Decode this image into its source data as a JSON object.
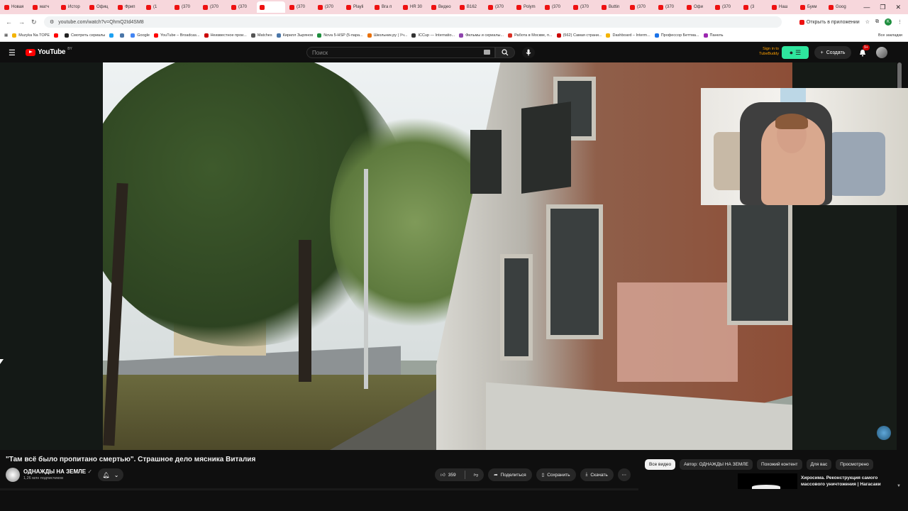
{
  "browser": {
    "tabs": [
      {
        "label": "Новая"
      },
      {
        "label": "матч"
      },
      {
        "label": "Истор"
      },
      {
        "label": "Офиц"
      },
      {
        "label": "Фрип"
      },
      {
        "label": "(1"
      },
      {
        "label": "(370"
      },
      {
        "label": "(370"
      },
      {
        "label": "(370"
      },
      {
        "label": ""
      },
      {
        "label": "(370"
      },
      {
        "label": "(370"
      },
      {
        "label": "Playli"
      },
      {
        "label": "Вга п"
      },
      {
        "label": "HR 30"
      },
      {
        "label": "Видео"
      },
      {
        "label": "В162"
      },
      {
        "label": "(370"
      },
      {
        "label": "Polym"
      },
      {
        "label": "(370"
      },
      {
        "label": "(370"
      },
      {
        "label": "Buttin"
      },
      {
        "label": "(370"
      },
      {
        "label": "(370"
      },
      {
        "label": "Офи"
      },
      {
        "label": "(370"
      },
      {
        "label": "(3"
      },
      {
        "label": "Наш"
      },
      {
        "label": "Букм"
      },
      {
        "label": "Goog"
      }
    ],
    "url": "youtube.com/watch?v=QhmQ2Id4SM8",
    "open_in_app": "Открыть в приложении",
    "profile_initial": "K",
    "bookmarks": [
      {
        "label": "Muzyka Na TOPE",
        "color": "#f4b400"
      },
      {
        "label": "",
        "color": "#ff0000"
      },
      {
        "label": "Смотреть сериалы",
        "color": "#222222"
      },
      {
        "label": "",
        "color": "#1da1f2"
      },
      {
        "label": "",
        "color": "#4a76a8"
      },
      {
        "label": "Google",
        "color": "#4285f4"
      },
      {
        "label": "YouTube – Broadcas...",
        "color": "#ff0000"
      },
      {
        "label": "Неизвестное прои...",
        "color": "#cc0000"
      },
      {
        "label": "Matches",
        "color": "#555555"
      },
      {
        "label": "Кирилл Зырянов",
        "color": "#4a76a8"
      },
      {
        "label": "Nova 5-HSP (5-пара...",
        "color": "#1e8e3e"
      },
      {
        "label": "Школьник.ру | Уч...",
        "color": "#e8710a"
      },
      {
        "label": "ICCup — Internatio...",
        "color": "#333333"
      },
      {
        "label": "Фильмы и сериалы...",
        "color": "#8e44ad"
      },
      {
        "label": "Работа в Москве, п...",
        "color": "#d93025"
      },
      {
        "label": "(562) Самая страни...",
        "color": "#cc0000"
      },
      {
        "label": "Dashboard – Interm...",
        "color": "#f4b400"
      },
      {
        "label": "Профессор Беттма...",
        "color": "#1a73e8"
      },
      {
        "label": "Панель",
        "color": "#9c27b0"
      }
    ],
    "all_bookmarks": "Все закладки"
  },
  "youtube": {
    "logo_text": "YouTube",
    "country": "BY",
    "search_placeholder": "Поиск",
    "signin_line1": "Sign in to",
    "signin_line2": "TubeBuddy",
    "create_label": "Создать",
    "notif_count": "9+"
  },
  "video": {
    "title": "\"Там всё было пропитано смертью\". Страшное дело мясника Виталия",
    "channel": "ОДНАЖДЫ НА ЗЕМЛЕ",
    "subscribers": "1,26 млн подписчиков",
    "likes": "359",
    "share_label": "Поделиться",
    "save_label": "Сохранить",
    "download_label": "Скачать"
  },
  "chips": [
    {
      "label": "Все видео",
      "active": true
    },
    {
      "label": "Автор: ОДНАЖДЫ НА ЗЕМЛЕ",
      "active": false
    },
    {
      "label": "Похожий контент",
      "active": false
    },
    {
      "label": "Для вас",
      "active": false
    },
    {
      "label": "Просмотрено",
      "active": false
    }
  ],
  "recommendation": {
    "title": "Хиросима. Реконструкция самого массового уничтожения | Нагасаки"
  },
  "colors": {
    "accent_red": "#ff0000",
    "tubebuddy_green": "#2ee59d",
    "tabbar_pink": "#f7d7dc"
  }
}
